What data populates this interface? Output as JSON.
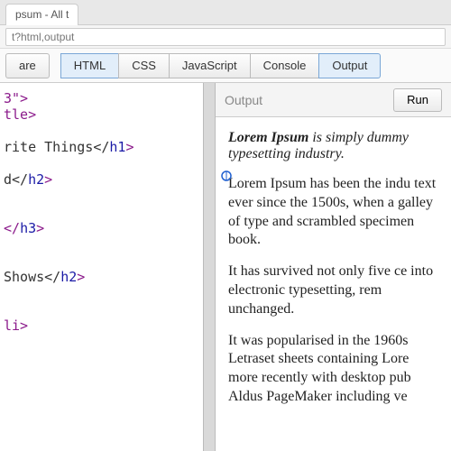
{
  "browser": {
    "tab_title": "psum - All t",
    "url": "t?html,output"
  },
  "toolbar": {
    "share": "are",
    "html": "HTML",
    "css": "CSS",
    "js": "JavaScript",
    "console": "Console",
    "output": "Output"
  },
  "code": {
    "l1a": "3\">",
    "l2a": "tle>",
    "l3": "",
    "l4a": "rite Things</",
    "l4b": "h1",
    "l4c": ">",
    "l5": "",
    "l6a": "d</",
    "l6b": "h2",
    "l6c": ">",
    "l7": "",
    "l8": "",
    "l9a": "</",
    "l9b": "h3",
    "l9c": ">",
    "l10": "",
    "l11": "",
    "l12a": "Shows</",
    "l12b": "h2",
    "l12c": ">",
    "l13": "",
    "l14": "",
    "l15a": "li>"
  },
  "output": {
    "label": "Output",
    "run": "Run",
    "intro_bold": "Lorem Ipsum",
    "intro_rest": " is simply dummy typesetting industry.",
    "p1": "Lorem Ipsum has been the indu text ever since the 1500s, when a galley of type and scrambled specimen book.",
    "p2": "It has survived not only five ce into electronic typesetting, rem unchanged.",
    "p3": "It was popularised in the 1960s Letraset sheets containing Lore more recently with desktop pub Aldus PageMaker including ve"
  }
}
